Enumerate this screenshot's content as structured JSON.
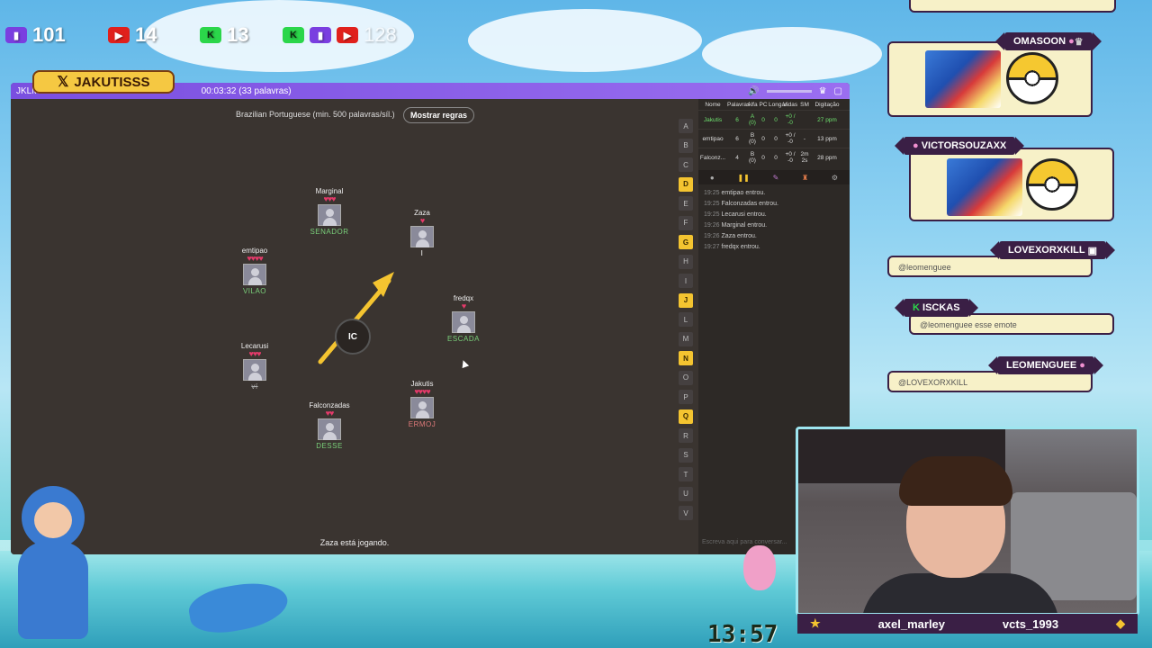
{
  "counters": {
    "twitch": "101",
    "youtube": "14",
    "kick": "13",
    "total": "128"
  },
  "banner": {
    "platform_icon": "x-icon",
    "name": "JAKUTISSS"
  },
  "game": {
    "title_left": "JKLM",
    "timer": "00:03:32 (33 palavras)",
    "language": "Brazilian Portuguese (min. 500 palavras/síl.)",
    "rules_button": "Mostrar regras",
    "syllable": "IC",
    "status": "Zaza está jogando.",
    "players": [
      {
        "name": "Marginal",
        "hearts": "♥♥♥",
        "word": "SENADOR"
      },
      {
        "name": "Zaza",
        "hearts": "♥",
        "word": "I"
      },
      {
        "name": "emtipao",
        "hearts": "♥♥♥♥",
        "word": "VILAO"
      },
      {
        "name": "fredqx",
        "hearts": "♥",
        "word": "ESCADA"
      },
      {
        "name": "Lecarusi",
        "hearts": "♥♥♥",
        "word": "ví"
      },
      {
        "name": "Jakutis",
        "hearts": "♥♥♥♥",
        "word": "ERMOJ"
      },
      {
        "name": "Falconzadas",
        "hearts": "♥♥",
        "word": "DESSE"
      }
    ],
    "letters": [
      "A",
      "B",
      "C",
      "D",
      "E",
      "F",
      "G",
      "H",
      "I",
      "J",
      "L",
      "M",
      "N",
      "O",
      "P",
      "Q",
      "R",
      "S",
      "T",
      "U",
      "V"
    ],
    "used_letters": [
      "D",
      "G",
      "J",
      "N",
      "Q"
    ],
    "scoreboard": {
      "headers": [
        "Nome",
        "Palavras",
        "Alfa",
        "PC",
        "Longas",
        "Vidas",
        "SM",
        "Digitação"
      ],
      "rows": [
        [
          "Jakutis",
          "6",
          "A (0)",
          "0",
          "0",
          "+0 / -0",
          "",
          "27 ppm"
        ],
        [
          "emtipao",
          "6",
          "B (0)",
          "0",
          "0",
          "+0 / -0",
          "-",
          "13 ppm"
        ],
        [
          "Falconz...",
          "4",
          "B (0)",
          "0",
          "0",
          "+0 / -0",
          "2m 2s",
          "28 ppm"
        ]
      ]
    },
    "chat_log": [
      {
        "time": "19:25",
        "text": "emtipao entrou."
      },
      {
        "time": "19:25",
        "text": "Falconzadas entrou."
      },
      {
        "time": "19:25",
        "text": "Lecarusi entrou."
      },
      {
        "time": "19:26",
        "text": "Marginal entrou."
      },
      {
        "time": "19:26",
        "text": "Zaza entrou."
      },
      {
        "time": "19:27",
        "text": "fredqx entrou."
      }
    ],
    "chat_placeholder": "Escreva aqui para conversar..."
  },
  "stream_chat": [
    {
      "user": "OMASOON",
      "message": ""
    },
    {
      "user": "VICTORSOUZAXX",
      "message": ""
    },
    {
      "user": "LOVEXORXKILL",
      "message": "@leomenguee"
    },
    {
      "user": "ISCKAS",
      "message": "@leomenguee esse emote"
    },
    {
      "user": "LEOMENGUEE",
      "message": "@LOVEXORXKILL"
    }
  ],
  "webcam": {
    "left_name": "axel_marley",
    "right_name": "vcts_1993"
  },
  "clock": "13:57",
  "colors": {
    "accent": "#7a4fe0",
    "banner": "#f5c842",
    "chat_tag": "#3a1f45",
    "used_letter": "#f4c430"
  }
}
